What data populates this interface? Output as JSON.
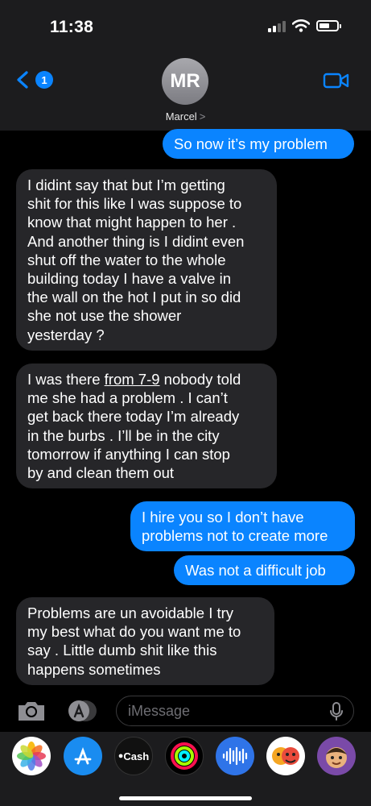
{
  "status_bar": {
    "time": "11:38"
  },
  "header": {
    "back_badge": "1",
    "avatar_initials": "MR",
    "contact_name": "Marcel",
    "contact_chevron": ">"
  },
  "messages": [
    {
      "from": "me",
      "text": "So now it’s my problem"
    },
    {
      "from": "them",
      "lines": [
        "I didint say that but I’m getting",
        "shit for this like I was suppose to",
        "know that might happen to her .",
        "And another thing is I didint even",
        "shut off the water to the whole",
        "building today I have a valve in",
        "the wall on the hot I put in so did",
        "she not use the shower",
        "yesterday ?"
      ]
    },
    {
      "from": "them",
      "line1_pre": "I was there ",
      "line1_link": "from 7-9",
      "line1_post": " nobody told",
      "lines": [
        "me she had a problem . I can’t",
        "get back there today I’m already",
        "in the burbs . I’ll be in the city",
        "tomorrow if anything I can stop",
        "by and clean them out"
      ]
    },
    {
      "from": "me",
      "lines": [
        "I hire you so I don’t have",
        "problems not to create more"
      ]
    },
    {
      "from": "me",
      "text": "Was not a difficult job"
    },
    {
      "from": "them",
      "lines": [
        "Problems are un avoidable I try",
        "my best what do you want me to",
        "say . Little dumb shit like this",
        "happens sometimes"
      ]
    }
  ],
  "composer": {
    "placeholder": "iMessage"
  },
  "app_drawer": {
    "apps": [
      "photos-app",
      "app-store-app",
      "apple-cash-app",
      "activity-app",
      "audio-message-app",
      "memoji-stickers-app",
      "memoji-app"
    ],
    "cash_label": "Cash"
  },
  "colors": {
    "sent_bubble": "#0a84ff",
    "received_bubble": "#262629",
    "background": "#000000",
    "header": "#1c1c1e"
  }
}
